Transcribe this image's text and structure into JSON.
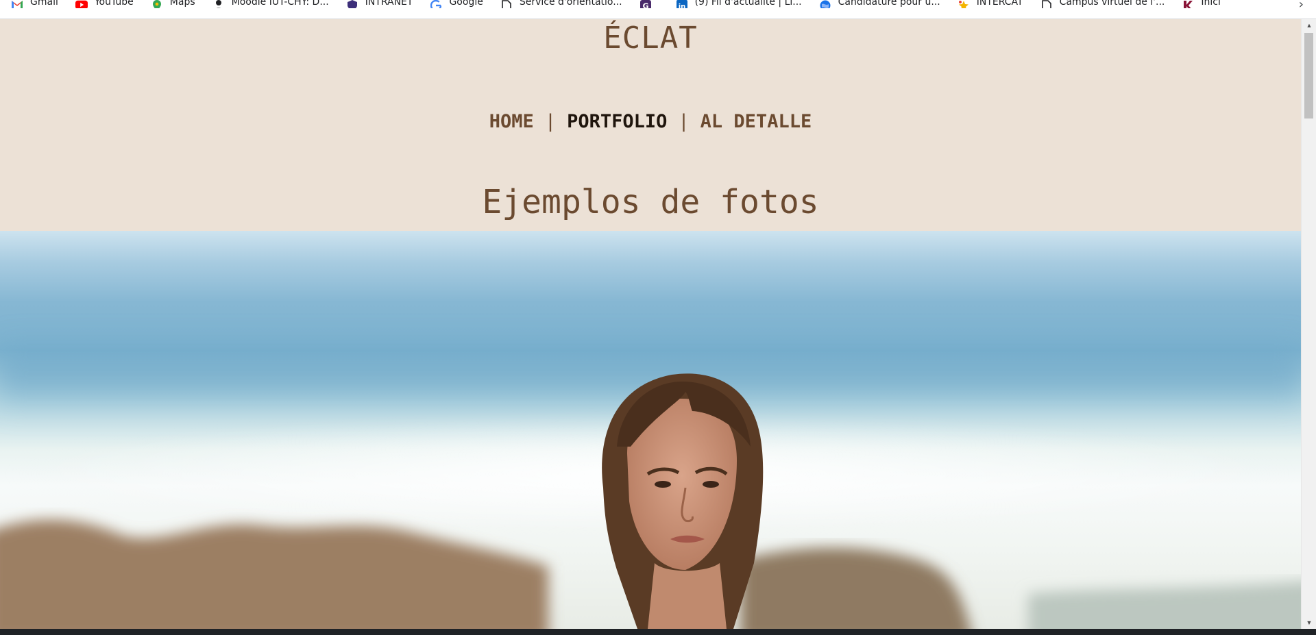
{
  "bookmarks": {
    "items": [
      {
        "label": "Gmail",
        "icon": "gmail-icon"
      },
      {
        "label": "YouTube",
        "icon": "youtube-icon"
      },
      {
        "label": "Maps",
        "icon": "maps-icon"
      },
      {
        "label": "Moodle IUT-CHY: D...",
        "icon": "person-icon"
      },
      {
        "label": "INTRANET",
        "icon": "shield-icon"
      },
      {
        "label": "Google",
        "icon": "google-icon"
      },
      {
        "label": "Service d'orientatio...",
        "icon": "page-icon"
      },
      {
        "label": "",
        "icon": "g-app-icon"
      },
      {
        "label": "(9) Fil d'actualité | Li...",
        "icon": "linkedin-icon"
      },
      {
        "label": "Candidature pour u...",
        "icon": "globe-icon"
      },
      {
        "label": "INTERCAT",
        "icon": "star-icon"
      },
      {
        "label": "Campus virtuel de l'...",
        "icon": "page-icon"
      },
      {
        "label": "Inici",
        "icon": "k-logo-icon"
      }
    ],
    "more": "›"
  },
  "site": {
    "title": "ÉCLAT",
    "nav": [
      {
        "label": "HOME",
        "active": false
      },
      {
        "label": "PORTFOLIO",
        "active": true
      },
      {
        "label": "AL DETALLE",
        "active": false
      }
    ],
    "separator": "|",
    "section_title": "Ejemplos de fotos"
  },
  "colors": {
    "page_bg": "#ece1d6",
    "accent_brown": "#6b4a30",
    "active_nav": "#1f150d"
  }
}
